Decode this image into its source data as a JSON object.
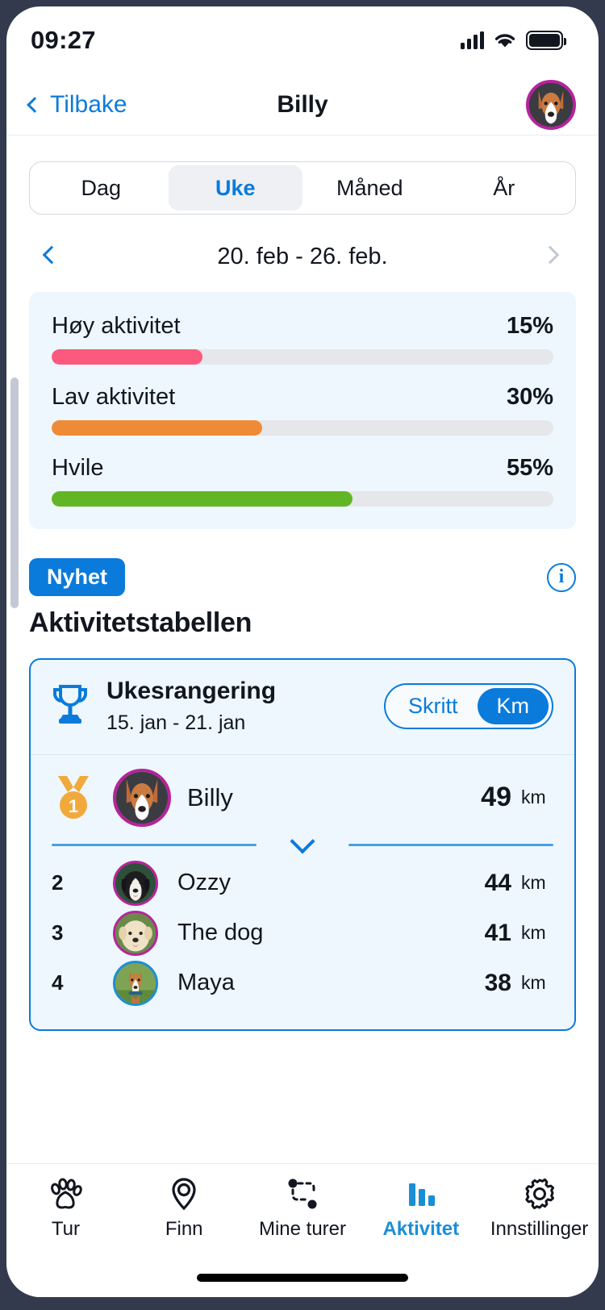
{
  "status_bar": {
    "time": "09:27",
    "signal_icon": "cellular-signal-icon",
    "wifi_icon": "wifi-icon",
    "battery_icon": "battery-full-icon"
  },
  "header": {
    "back_label": "Tilbake",
    "title": "Billy",
    "avatar_name": "Billy"
  },
  "period_tabs": {
    "items": [
      {
        "label": "Dag",
        "active": false
      },
      {
        "label": "Uke",
        "active": true
      },
      {
        "label": "Måned",
        "active": false
      },
      {
        "label": "År",
        "active": false
      }
    ]
  },
  "date_pager": {
    "range": "20. feb - 26. feb.",
    "prev_icon": "chevron-left-icon",
    "next_icon": "chevron-right-icon"
  },
  "activity_summary": {
    "rows": [
      {
        "label": "Høy aktivitet",
        "value": "15%",
        "bar_percent": 30,
        "color": "#fb5a7e"
      },
      {
        "label": "Lav aktivitet",
        "value": "30%",
        "bar_percent": 42,
        "color": "#ef8b36"
      },
      {
        "label": "Hvile",
        "value": "55%",
        "bar_percent": 60,
        "color": "#62b524"
      }
    ]
  },
  "news": {
    "badge": "Nyhet",
    "title": "Aktivitetstabellen",
    "info_icon": "info-circle-icon",
    "info_glyph": "i"
  },
  "ranking": {
    "trophy_icon": "trophy-icon",
    "title": "Ukesrangering",
    "subtitle": "15. jan - 21. jan",
    "unit_toggle": {
      "options": [
        {
          "label": "Skritt",
          "active": false
        },
        {
          "label": "Km",
          "active": true
        }
      ]
    },
    "expand_icon": "chevron-down-icon",
    "rows": [
      {
        "position": "1",
        "medal": true,
        "name": "Billy",
        "distance": "49",
        "unit": "km",
        "ring": "magenta"
      },
      {
        "position": "2",
        "medal": false,
        "name": "Ozzy",
        "distance": "44",
        "unit": "km",
        "ring": "magenta"
      },
      {
        "position": "3",
        "medal": false,
        "name": "The dog",
        "distance": "41",
        "unit": "km",
        "ring": "magenta"
      },
      {
        "position": "4",
        "medal": false,
        "name": "Maya",
        "distance": "38",
        "unit": "km",
        "ring": "blue"
      }
    ]
  },
  "tab_bar": {
    "items": [
      {
        "label": "Tur",
        "icon": "paw-icon",
        "active": false
      },
      {
        "label": "Finn",
        "icon": "map-pin-icon",
        "active": false
      },
      {
        "label": "Mine turer",
        "icon": "route-icon",
        "active": false
      },
      {
        "label": "Aktivitet",
        "icon": "bar-chart-icon",
        "active": true
      },
      {
        "label": "Innstillinger",
        "icon": "gear-icon",
        "active": false
      }
    ]
  },
  "colors": {
    "accent_blue": "#0a7bdb",
    "panel_blue": "#eef7fd",
    "high_activity": "#fb5a7e",
    "low_activity": "#ef8b36",
    "rest": "#62b524",
    "ring_magenta": "#b5249b",
    "ring_blue": "#1a8fd6",
    "text_dark": "#12161f"
  }
}
